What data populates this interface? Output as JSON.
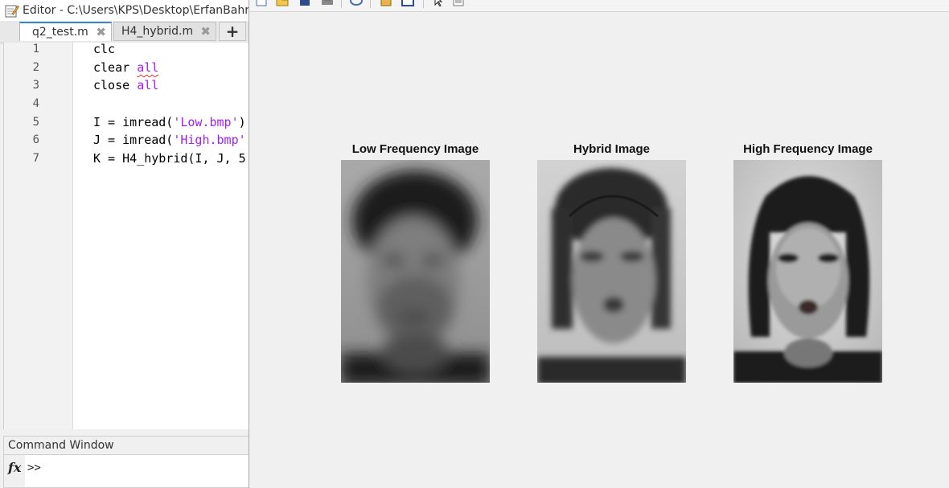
{
  "editor": {
    "title": "Editor - C:\\Users\\KPS\\Desktop\\ErfanBahra",
    "tabs": [
      {
        "label": "q2_test.m",
        "close": "✖"
      },
      {
        "label": "H4_hybrid.m",
        "close": "✖"
      }
    ],
    "add_tab": "+",
    "line_numbers": [
      "1",
      "2",
      "3",
      "4",
      "5",
      "6",
      "7"
    ],
    "code": {
      "l1": "clc",
      "l2a": "clear ",
      "l2b": "all",
      "l3a": "close ",
      "l3b": "all",
      "l5a": "I = imread(",
      "l5b": "'Low.bmp'",
      "l5c": ")",
      "l6a": "J = imread(",
      "l6b": "'High.bmp'",
      "l7": "K = H4_hybrid(I, J, 5"
    }
  },
  "command_window": {
    "title": "Command Window",
    "fx": "fx",
    "prompt": ">>"
  },
  "figure": {
    "panels": [
      {
        "title": "Low Frequency Image"
      },
      {
        "title": "Hybrid Image"
      },
      {
        "title": "High Frequency Image"
      }
    ]
  },
  "colors": {
    "keyword": "#a020f0",
    "string": "#a020f0",
    "active_tab_accent": "#3b86c9"
  },
  "icons": [
    "editor-icon",
    "close-icon",
    "plus-icon",
    "fx-icon",
    "new-figure-icon",
    "open-icon",
    "save-icon",
    "print-icon",
    "link-icon",
    "insert-colorbar-icon",
    "insert-legend-icon",
    "pointer-icon",
    "property-editor-icon"
  ]
}
